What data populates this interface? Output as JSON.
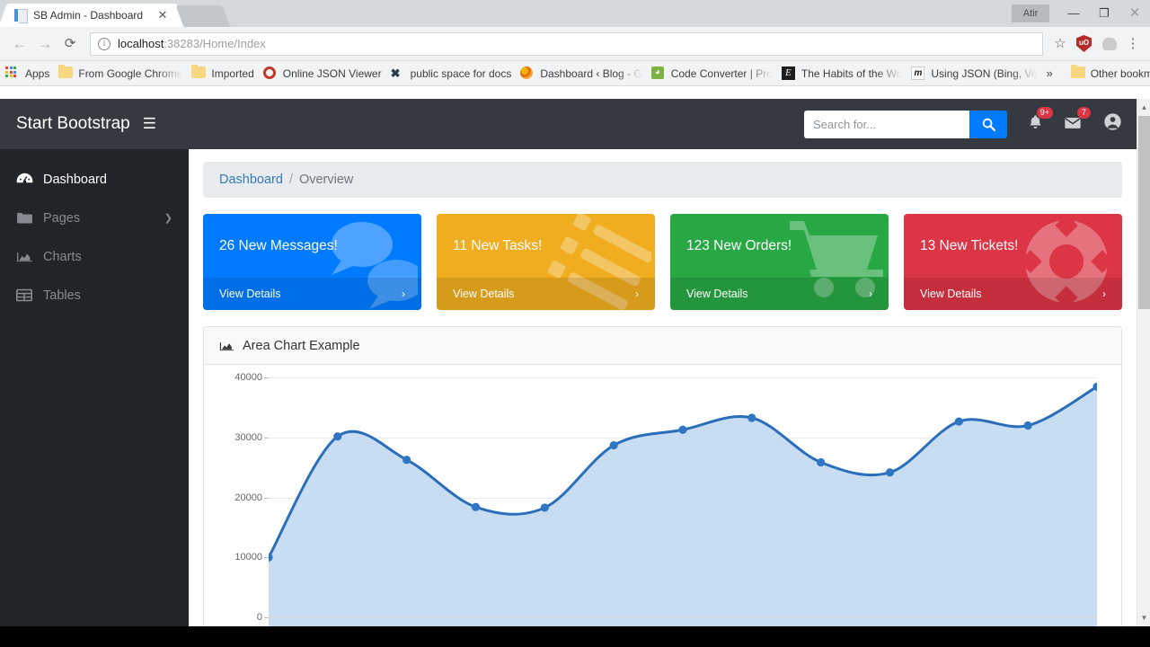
{
  "browser": {
    "tab_title": "SB Admin - Dashboard",
    "tab_close": "✕",
    "window_button_label": "Atir",
    "minimize": "—",
    "maximize": "❐",
    "close": "✕",
    "back": "←",
    "forward": "→",
    "reload": "⟳",
    "info_icon": "i",
    "url_host": "localhost",
    "url_rest": ":38283/Home/Index",
    "star": "☆",
    "shield_label": "uO",
    "kebab": "⋮",
    "bookmarks": [
      {
        "label": "Apps",
        "icon": "apps-grid-icon"
      },
      {
        "label": "From Google Chrome",
        "icon": "folder-icon"
      },
      {
        "label": "Imported",
        "icon": "folder-icon"
      },
      {
        "label": "Online JSON Viewer",
        "icon": "ring-icon"
      },
      {
        "label": "public space for docs",
        "icon": "x-icon"
      },
      {
        "label": "Dashboard ‹ Blog - G",
        "icon": "swirl-icon"
      },
      {
        "label": "Code Converter | Pro",
        "icon": "rss-icon"
      },
      {
        "label": "The Habits of the Wo",
        "icon": "evernote-icon"
      },
      {
        "label": "Using JSON (Bing, Ve",
        "icon": "m-icon"
      }
    ],
    "overflow_chevron": "»",
    "other_bookmarks": "Other bookmarks"
  },
  "navbar": {
    "brand": "Start Bootstrap",
    "burger": "☰",
    "search": {
      "placeholder": "Search for...",
      "value": ""
    },
    "alerts_badge": "9+",
    "messages_badge": "7"
  },
  "sidebar": {
    "items": [
      {
        "label": "Dashboard",
        "icon": "tachometer-icon",
        "active": true,
        "chevron": ""
      },
      {
        "label": "Pages",
        "icon": "folder-icon",
        "active": false,
        "chevron": "❯"
      },
      {
        "label": "Charts",
        "icon": "chart-area-icon",
        "active": false,
        "chevron": ""
      },
      {
        "label": "Tables",
        "icon": "table-icon",
        "active": false,
        "chevron": ""
      }
    ]
  },
  "breadcrumb": {
    "root": "Dashboard",
    "separator": "/",
    "current": "Overview"
  },
  "cards": [
    {
      "title": "26 New Messages!",
      "action": "View Details",
      "arrow": "›",
      "color": "#007bff",
      "icon": "comments-icon"
    },
    {
      "title": "11 New Tasks!",
      "action": "View Details",
      "arrow": "›",
      "color": "#f0ad20",
      "icon": "list-icon"
    },
    {
      "title": "123 New Orders!",
      "action": "View Details",
      "arrow": "›",
      "color": "#28a745",
      "icon": "shopping-cart-icon"
    },
    {
      "title": "13 New Tickets!",
      "action": "View Details",
      "arrow": "›",
      "color": "#dc3545",
      "icon": "life-ring-icon"
    }
  ],
  "chart_panel": {
    "title": "Area Chart Example",
    "icon": "chart-area-icon"
  },
  "chart_data": {
    "type": "area",
    "title": "Area Chart Example",
    "xlabel": "",
    "ylabel": "",
    "ylim": [
      0,
      40000
    ],
    "yticks": [
      0,
      10000,
      20000,
      30000,
      40000
    ],
    "ytick_labels": [
      "0",
      "10000",
      "20000",
      "30000",
      "40000"
    ],
    "grid": true,
    "legend": "none",
    "line_color": "#2a6ebb",
    "fill_color": "#c8ddf2",
    "point_color": "#2e75c4",
    "x": [
      1,
      2,
      3,
      4,
      5,
      6,
      7,
      8,
      9,
      10,
      11,
      12,
      13
    ],
    "values": [
      10000,
      30162,
      26263,
      18394,
      18287,
      28682,
      31274,
      33259,
      25849,
      24159,
      32651,
      31984,
      38451
    ]
  }
}
